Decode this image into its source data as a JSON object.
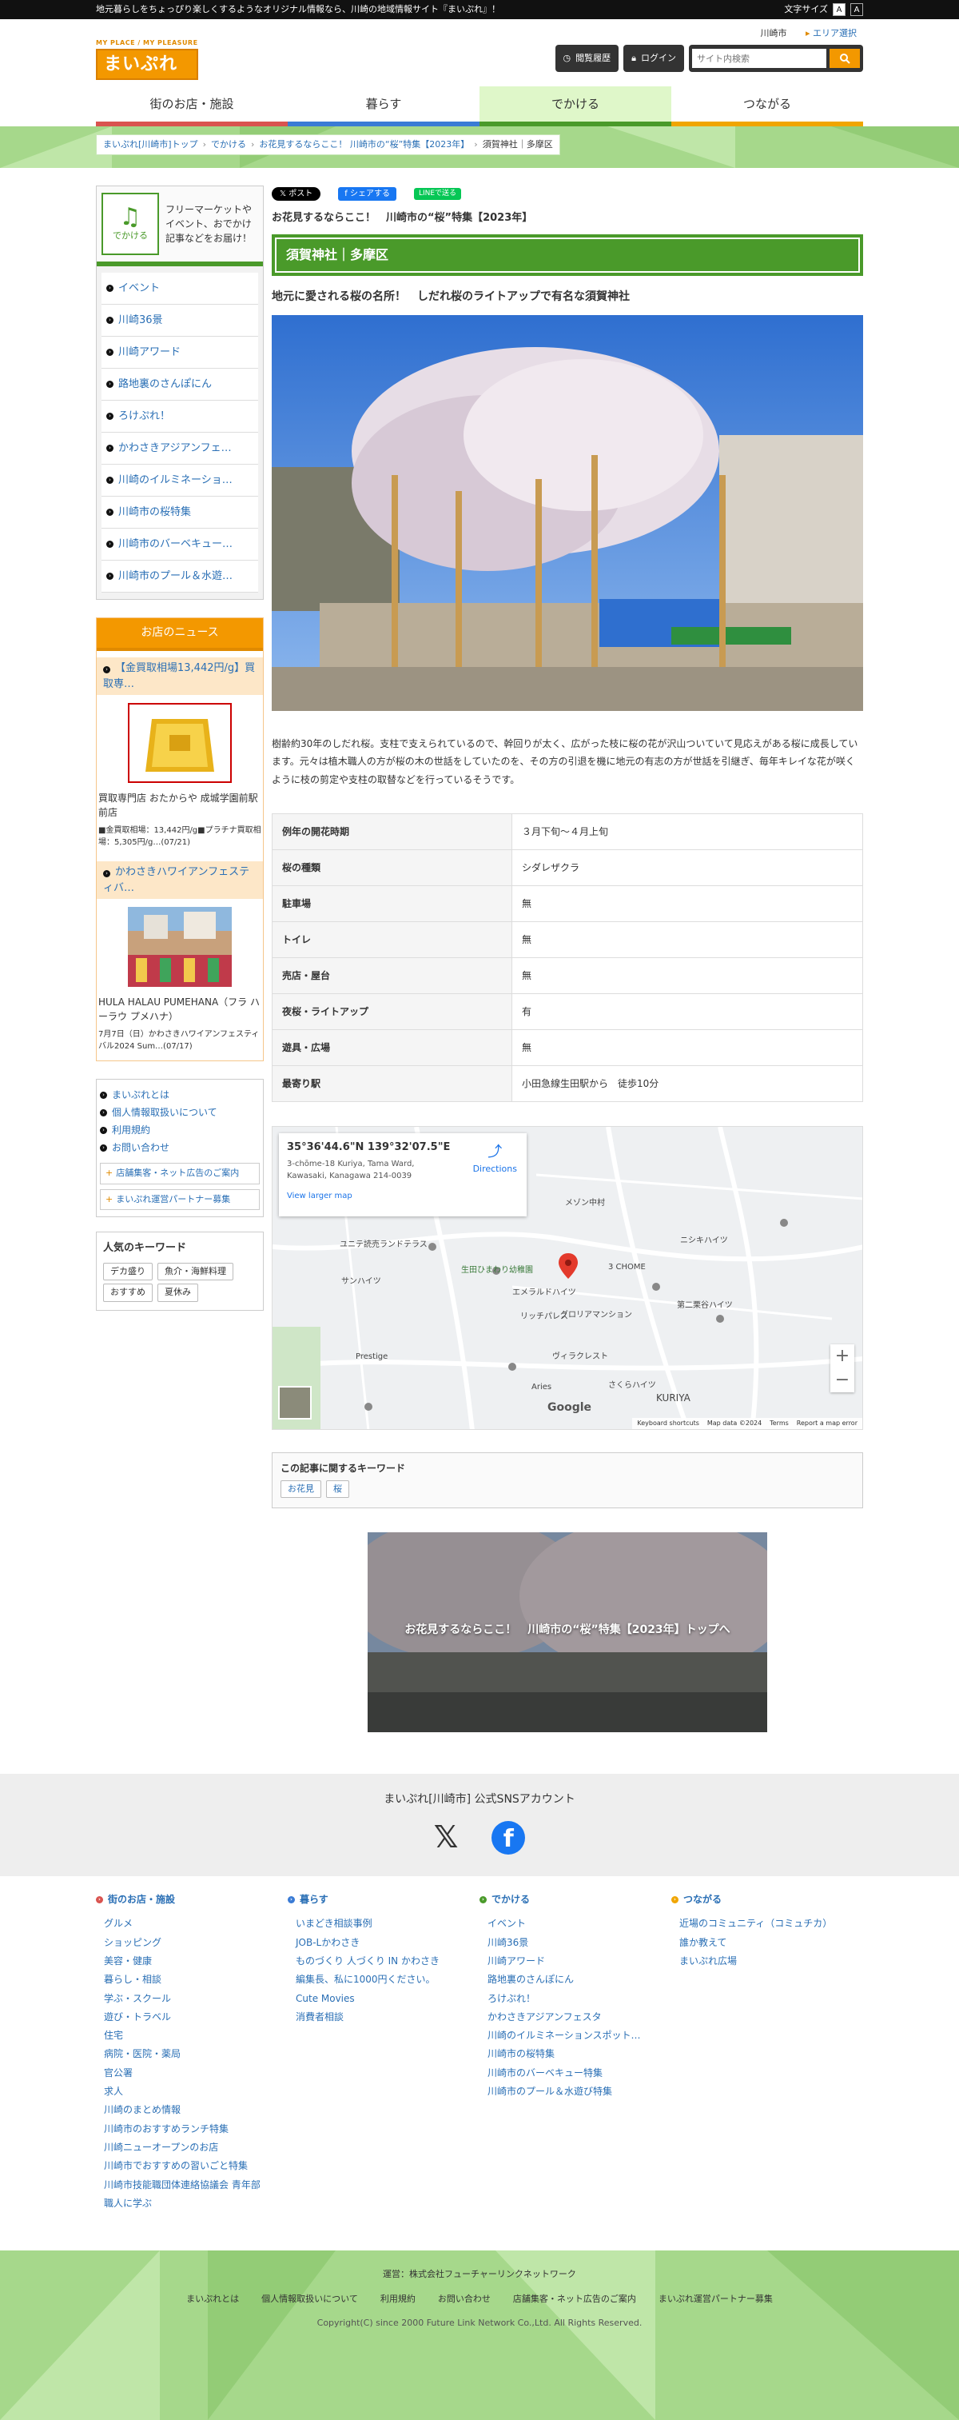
{
  "topbar": {
    "tagline": "地元暮らしをちょっぴり楽しくするようなオリジナル情報なら、川崎の地域情報サイト『まいぷれ』！",
    "fontsize_label": "文字サイズ",
    "font_small": "A",
    "font_large": "A"
  },
  "header": {
    "logo_tag": "MY PLACE / MY PLEASURE",
    "logo_text": "まいぷれ",
    "region": "川崎市",
    "area_select": "エリア選択",
    "history_label": "閲覧履歴",
    "login_label": "ログイン",
    "search_placeholder": "サイト内検索"
  },
  "gnav": [
    {
      "label": "街のお店・施設",
      "color": "#d9534f"
    },
    {
      "label": "暮らす",
      "color": "#3a7bd5"
    },
    {
      "label": "でかける",
      "color": "#4a9a2a"
    },
    {
      "label": "つながる",
      "color": "#f0a500"
    }
  ],
  "breadcrumb": [
    "まいぷれ[川崎市]トップ",
    "でかける",
    "お花見するならここ！ 川崎市の“桜”特集【2023年】",
    "須賀神社｜多摩区"
  ],
  "sidebar": {
    "category_label": "でかける",
    "category_desc": "フリーマーケットやイベント、おでかけ記事などをお届け！",
    "items": [
      "イベント",
      "川崎36景",
      "川崎アワード",
      "路地裏のさんぽにん",
      "ろけぷれ！",
      "かわさきアジアンフェ…",
      "川崎のイルミネーショ…",
      "川崎市の桜特集",
      "川崎市のバーベキュー…",
      "川崎市のプール＆水遊…"
    ],
    "news_title": "お店のニュース",
    "news": [
      {
        "tag": "【金買取相場13,442円/g】買取専…",
        "title": "買取専門店 おたからや 成城学園前駅前店",
        "meta": "■金買取相場：13,442円/g■プラチナ買取相場：5,305円/g…(07/21)"
      },
      {
        "tag": "かわさきハワイアンフェスティバ…",
        "title": "HULA HALAU PUMEHANA（フラ ハーラウ プメハナ）",
        "meta": "7月7日（日）かわさきハワイアンフェスティバル2024 Sum…(07/17)"
      }
    ],
    "info_links": [
      "まいぷれとは",
      "個人情報取扱いについて",
      "利用規約",
      "お問い合わせ"
    ],
    "partner_links": [
      "店舗集客・ネット広告のご案内",
      "まいぷれ運営パートナー募集"
    ],
    "keywords_title": "人気のキーワード",
    "keywords": [
      "デカ盛り",
      "魚介・海鮮料理",
      "おすすめ",
      "夏休み"
    ]
  },
  "article": {
    "share_x": "𝕏 ポスト",
    "share_fb": "f シェアする",
    "share_line": "LINEで送る",
    "feature_title": "お花見するならここ！　川崎市の“桜”特集【2023年】",
    "place_title": "須賀神社｜多摩区",
    "lead": "地元に愛される桜の名所！　しだれ桜のライトアップで有名な須賀神社",
    "body": "樹齢約30年のしだれ桜。支柱で支えられているので、幹回りが太く、広がった枝に桜の花が沢山ついていて見応えがある桜に成長しています。元々は植木職人の方が桜の木の世話をしていたのを、その方の引退を機に地元の有志の方が世話を引継ぎ、毎年キレイな花が咲くように枝の剪定や支柱の取替などを行っているそうです。",
    "info_rows": [
      {
        "k": "例年の開花時期",
        "v": "３月下旬〜４月上旬"
      },
      {
        "k": "桜の種類",
        "v": "シダレザクラ"
      },
      {
        "k": "駐車場",
        "v": "無"
      },
      {
        "k": "トイレ",
        "v": "無"
      },
      {
        "k": "売店・屋台",
        "v": "無"
      },
      {
        "k": "夜桜・ライトアップ",
        "v": "有"
      },
      {
        "k": "遊具・広場",
        "v": "無"
      },
      {
        "k": "最寄り駅",
        "v": "小田急線生田駅から　徒歩10分"
      }
    ],
    "map": {
      "coord": "35°36'44.6\"N 139°32'07.5\"E",
      "address": "3-chōme-18 Kuriya, Tama Ward, Kawasaki, Kanagawa 214-0039",
      "directions": "Directions",
      "larger": "View larger map",
      "google": "Google",
      "footer": [
        "Keyboard shortcuts",
        "Map data ©2024",
        "Terms",
        "Report a map error"
      ],
      "labels": [
        "生田ひまわり幼稚園",
        "エメラルドハイツ",
        "グロリアマンション",
        "ヴィラクレスト",
        "3 CHOME",
        "KURIYA",
        "Prestige",
        "リッチパレス",
        "ユニテ読売ランドテラス",
        "メゾン中村",
        "ニシキハイツ",
        "第二栗谷ハイツ",
        "サンハイツ",
        "Aries",
        "さくらハイツ"
      ]
    },
    "kw_title": "この記事に関するキーワード",
    "kw_tags": [
      "お花見",
      "桜"
    ],
    "feature_link": "お花見するならここ！　川崎市の“桜”特集【2023年】トップへ"
  },
  "sns": {
    "title": "まいぷれ[川崎市] 公式SNSアカウント"
  },
  "footer_nav": [
    {
      "title": "街のお店・施設",
      "color": "#d9534f",
      "items": [
        "グルメ",
        "ショッピング",
        "美容・健康",
        "暮らし・相談",
        "学ぶ・スクール",
        "遊び・トラベル",
        "住宅",
        "病院・医院・薬局",
        "官公署",
        "求人",
        "川崎のまとめ情報",
        "川崎市のおすすめランチ特集",
        "川崎ニューオープンのお店",
        "川崎市でおすすめの習いごと特集",
        "川崎市技能職団体連絡協議会 青年部",
        "職人に学ぶ"
      ]
    },
    {
      "title": "暮らす",
      "color": "#3a7bd5",
      "items": [
        "いまどき相談事例",
        "JOB-Lかわさき",
        "ものづくり 人づくり IN かわさき",
        "編集長、私に1000円ください。",
        "Cute Movies",
        "消費者相談"
      ]
    },
    {
      "title": "でかける",
      "color": "#4a9a2a",
      "items": [
        "イベント",
        "川崎36景",
        "川崎アワード",
        "路地裏のさんぽにん",
        "ろけぷれ！",
        "かわさきアジアンフェスタ",
        "川崎のイルミネーションスポット…",
        "川崎市の桜特集",
        "川崎市のバーベキュー特集",
        "川崎市のプール＆水遊び特集"
      ]
    },
    {
      "title": "つながる",
      "color": "#f0a500",
      "items": [
        "近場のコミュニティ（コミュチカ）",
        "誰か教えて",
        "まいぷれ広場"
      ]
    }
  ],
  "footer": {
    "operator": "運営：株式会社フューチャーリンクネットワーク",
    "links": [
      "まいぷれとは",
      "個人情報取扱いについて",
      "利用規約",
      "お問い合わせ",
      "店舗集客・ネット広告のご案内",
      "まいぷれ運営パートナー募集"
    ],
    "copyright": "Copyright(C) since 2000 Future Link Network Co.,Ltd. All Rights Reserved."
  }
}
